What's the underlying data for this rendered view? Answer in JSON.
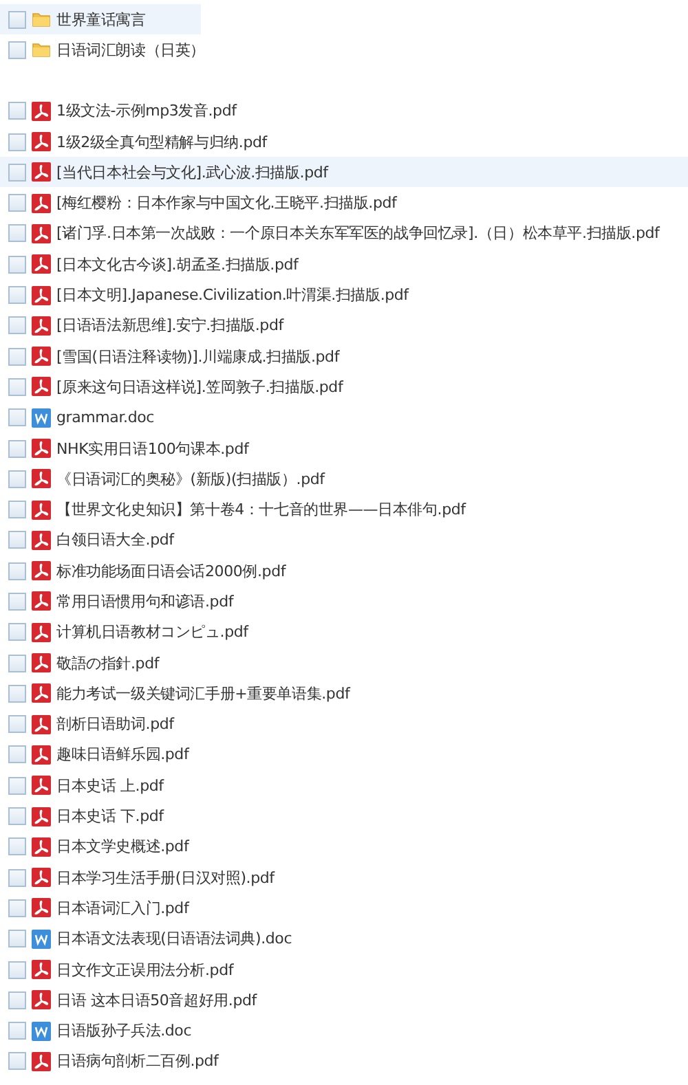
{
  "folders": [
    {
      "kind": "folder",
      "name": "世界童话寓言",
      "checked": false,
      "selected": true
    },
    {
      "kind": "folder",
      "name": "日语词汇朗读（日英）",
      "checked": false,
      "selected": false
    }
  ],
  "files": [
    {
      "kind": "pdf",
      "name": "1级文法-示例mp3发音.pdf",
      "checked": false,
      "selected": false
    },
    {
      "kind": "pdf",
      "name": "1级2级全真句型精解与归纳.pdf",
      "checked": false,
      "selected": false
    },
    {
      "kind": "pdf",
      "name": "[当代日本社会与文化].武心波.扫描版.pdf",
      "checked": false,
      "selected": true
    },
    {
      "kind": "pdf",
      "name": "[梅红樱粉：日本作家与中国文化.王晓平.扫描版.pdf",
      "checked": false,
      "selected": false
    },
    {
      "kind": "pdf",
      "name": "[诸门孚.日本第一次战败：一个原日本关东军军医的战争回忆录].（日）松本草平.扫描版.pdf",
      "checked": false,
      "selected": false
    },
    {
      "kind": "pdf",
      "name": "[日本文化古今谈].胡孟圣.扫描版.pdf",
      "checked": false,
      "selected": false
    },
    {
      "kind": "pdf",
      "name": "[日本文明].Japanese.Civilization.叶渭渠.扫描版.pdf",
      "checked": false,
      "selected": false
    },
    {
      "kind": "pdf",
      "name": "[日语语法新思维].安宁.扫描版.pdf",
      "checked": false,
      "selected": false
    },
    {
      "kind": "pdf",
      "name": "[雪国(日语注释读物)].川端康成.扫描版.pdf",
      "checked": false,
      "selected": false
    },
    {
      "kind": "pdf",
      "name": "[原来这句日语这样说].笠岡敦子.扫描版.pdf",
      "checked": false,
      "selected": false
    },
    {
      "kind": "doc",
      "name": "grammar.doc",
      "checked": false,
      "selected": false
    },
    {
      "kind": "pdf",
      "name": "NHK实用日语100句课本.pdf",
      "checked": false,
      "selected": false
    },
    {
      "kind": "pdf",
      "name": "《日语词汇的奥秘》(新版)(扫描版）.pdf",
      "checked": false,
      "selected": false
    },
    {
      "kind": "pdf",
      "name": "【世界文化史知识】第十卷4：十七音的世界——日本俳句.pdf",
      "checked": false,
      "selected": false
    },
    {
      "kind": "pdf",
      "name": "白领日语大全.pdf",
      "checked": false,
      "selected": false
    },
    {
      "kind": "pdf",
      "name": "标准功能场面日语会话2000例.pdf",
      "checked": false,
      "selected": false
    },
    {
      "kind": "pdf",
      "name": "常用日语惯用句和谚语.pdf",
      "checked": false,
      "selected": false
    },
    {
      "kind": "pdf",
      "name": "计算机日语教材コンピュ.pdf",
      "checked": false,
      "selected": false
    },
    {
      "kind": "pdf",
      "name": "敬語の指針.pdf",
      "checked": false,
      "selected": false
    },
    {
      "kind": "pdf",
      "name": "能力考试一级关键词汇手册+重要单语集.pdf",
      "checked": false,
      "selected": false
    },
    {
      "kind": "pdf",
      "name": "剖析日语助词.pdf",
      "checked": false,
      "selected": false
    },
    {
      "kind": "pdf",
      "name": "趣味日语鲜乐园.pdf",
      "checked": false,
      "selected": false
    },
    {
      "kind": "pdf",
      "name": "日本史话 上.pdf",
      "checked": false,
      "selected": false
    },
    {
      "kind": "pdf",
      "name": "日本史话 下.pdf",
      "checked": false,
      "selected": false
    },
    {
      "kind": "pdf",
      "name": "日本文学史概述.pdf",
      "checked": false,
      "selected": false
    },
    {
      "kind": "pdf",
      "name": "日本学习生活手册(日汉对照).pdf",
      "checked": false,
      "selected": false
    },
    {
      "kind": "pdf",
      "name": "日本语词汇入门.pdf",
      "checked": false,
      "selected": false
    },
    {
      "kind": "doc",
      "name": "日本语文法表现(日语语法词典).doc",
      "checked": false,
      "selected": false
    },
    {
      "kind": "pdf",
      "name": "日文作文正误用法分析.pdf",
      "checked": false,
      "selected": false
    },
    {
      "kind": "pdf",
      "name": "日语 这本日语50音超好用.pdf",
      "checked": false,
      "selected": false
    },
    {
      "kind": "doc",
      "name": "日语版孙子兵法.doc",
      "checked": false,
      "selected": false
    },
    {
      "kind": "pdf",
      "name": "日语病句剖析二百例.pdf",
      "checked": false,
      "selected": false
    }
  ]
}
